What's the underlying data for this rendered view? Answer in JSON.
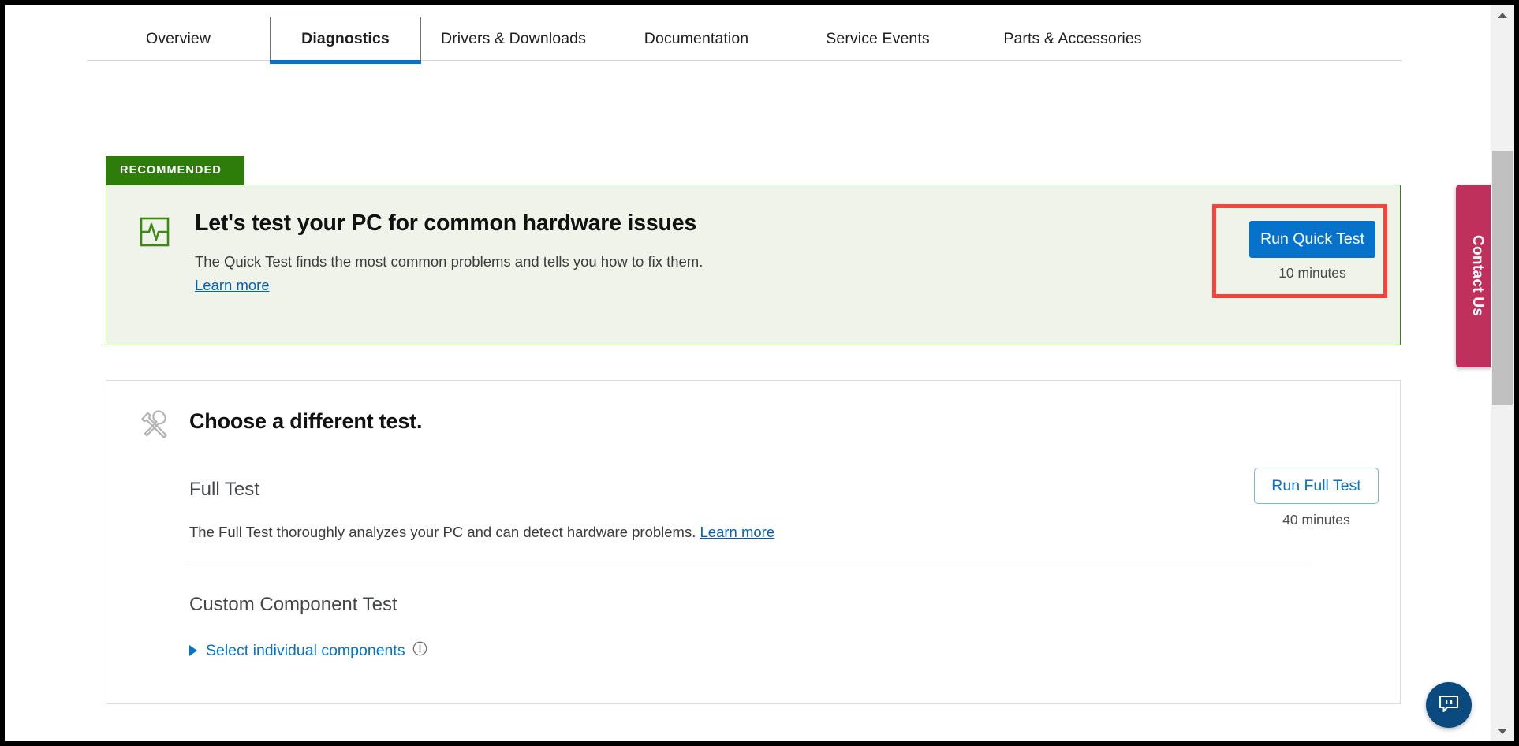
{
  "tabs": [
    {
      "label": "Overview",
      "active": false
    },
    {
      "label": "Diagnostics",
      "active": true
    },
    {
      "label": "Drivers & Downloads",
      "active": false
    },
    {
      "label": "Documentation",
      "active": false
    },
    {
      "label": "Service Events",
      "active": false
    },
    {
      "label": "Parts & Accessories",
      "active": false
    }
  ],
  "banner": {
    "badge": "RECOMMENDED",
    "title": "Let's test your PC for common hardware issues",
    "description": "The Quick Test finds the most common problems and tells you how to fix them.",
    "link": "Learn more",
    "button": "Run Quick Test",
    "duration": "10 minutes",
    "icon": "heartbeat-monitor-icon",
    "accent_color": "#3c7d0e",
    "badge_color": "#2e7d0a",
    "background_color": "#f0f3ea",
    "button_color": "#0672cb",
    "highlight_color": "#f9423a"
  },
  "card": {
    "title": "Choose a different test.",
    "icon": "wrench-screwdriver-icon",
    "full_test": {
      "title": "Full Test",
      "description": "The Full Test thoroughly analyzes your PC and can detect hardware problems.",
      "link": "Learn more",
      "button": "Run Full Test",
      "duration": "40 minutes"
    },
    "custom_test": {
      "title": "Custom Component Test",
      "link": "Select individual components",
      "info_icon": "info-exclamation-icon"
    }
  },
  "contact_tab": {
    "label": "Contact Us",
    "color": "#c0305d"
  },
  "chat": {
    "icon": "chat-bubble-icon",
    "color": "#0b4a7f"
  },
  "scrollbar": {
    "up_icon": "scroll-up-arrow-icon",
    "down_icon": "scroll-down-arrow-icon"
  }
}
